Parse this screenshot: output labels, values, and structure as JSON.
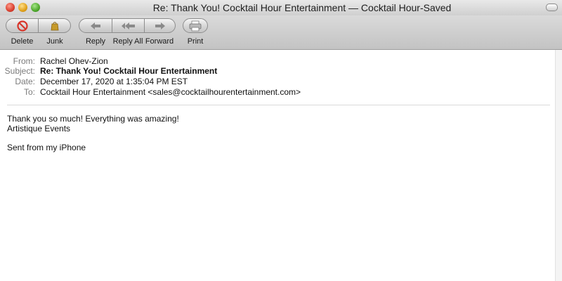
{
  "window": {
    "title": "Re: Thank You! Cocktail Hour Entertainment — Cocktail Hour-Saved"
  },
  "toolbar": {
    "buttons": [
      {
        "label": "Delete",
        "icon": "delete-icon"
      },
      {
        "label": "Junk",
        "icon": "junk-bag-icon"
      },
      {
        "label": "Reply",
        "icon": "reply-arrow-icon"
      },
      {
        "label": "Reply All",
        "icon": "reply-all-arrow-icon"
      },
      {
        "label": "Forward",
        "icon": "forward-arrow-icon"
      },
      {
        "label": "Print",
        "icon": "printer-icon"
      }
    ]
  },
  "header": {
    "from_label": "From:",
    "from_value": "Rachel Ohev-Zion",
    "subject_label": "Subject:",
    "subject_value": "Re: Thank You! Cocktail Hour Entertainment",
    "date_label": "Date:",
    "date_value": "December 17, 2020 at 1:35:04 PM EST",
    "to_label": "To:",
    "to_value": "Cocktail Hour Entertainment <sales@cocktailhourentertainment.com>"
  },
  "message": {
    "lines": [
      "Thank you so much! Everything was amazing!",
      "Artistique Events",
      "",
      "Sent from my iPhone"
    ]
  },
  "colors": {
    "delete_red": "#d8352a",
    "junk_gold": "#c69a2a",
    "arrow_gray": "#8a8a8a"
  }
}
